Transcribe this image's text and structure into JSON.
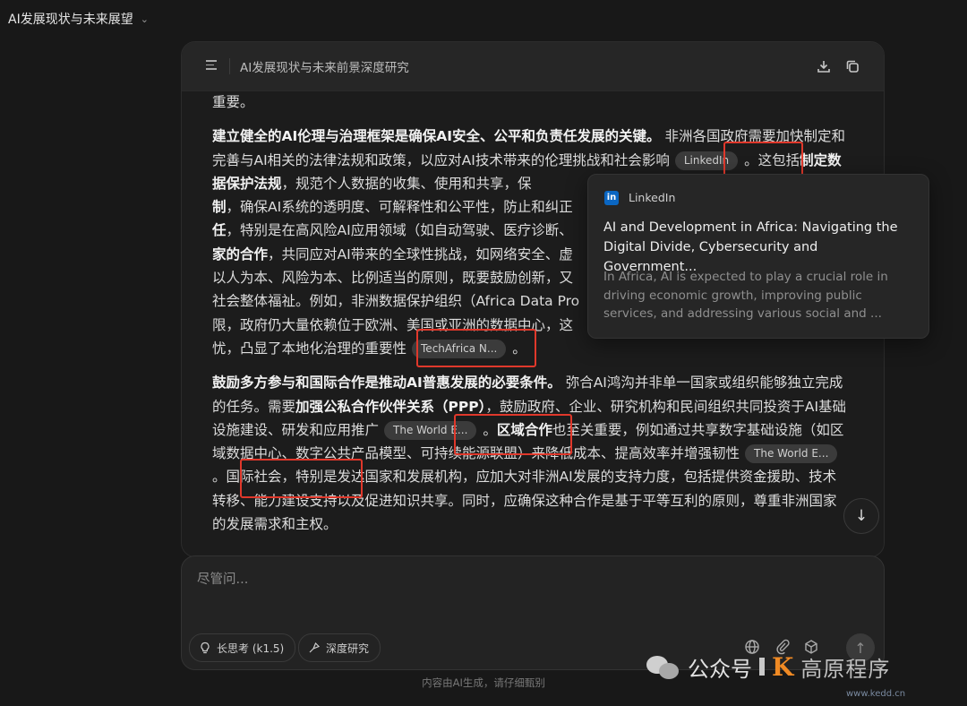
{
  "top_bar": {
    "title": "AI发展现状与未来展望",
    "dropdown_icon": "chevron-down-icon"
  },
  "card": {
    "title": "AI发展现状与未来前景深度研究",
    "icons": [
      "menu-icon",
      "download-icon",
      "copy-icon"
    ]
  },
  "article": {
    "p0": {
      "t1": "重要。"
    },
    "p1": {
      "b1": "建立健全的AI伦理与治理框架是确保AI安全、公平和负责任发展的关键。",
      "t1": "非洲各国政府需要加快制定和完善与AI相关的法律法规和政策，以应对AI技术带来的伦理挑战和社会影响",
      "chip1": "LinkedIn",
      "t2": "。这包括",
      "b2": "制定数据保护法规",
      "t3": "，规范个人数据的收集、使用和共享，保",
      "b3": "制",
      "t4": "，确保AI系统的透明度、可解释性和公平性，防止和纠正",
      "b4": "任",
      "t5": "，特别是在高风险AI应用领域（如自动驾驶、医疗诊断、",
      "b5": "家的合作",
      "t6": "，共同应对AI带来的全球性挑战，如网络安全、虚",
      "t7": "以人为本、风险为本、比例适当的原则，既要鼓励创新，又",
      "t8": "社会整体福祉。例如，非洲数据保护组织（Africa Data Pro",
      "t9": "限，政府仍大量依赖位于欧洲、美国或亚洲的数据中心，这",
      "t10": "忧，凸显了本地化治理的重要性",
      "chip2": "TechAfrica N...",
      "t11": "。"
    },
    "p2": {
      "b1": "鼓励多方参与和国际合作是推动AI普惠发展的必要条件。",
      "t1": "弥合AI鸿沟并非单一国家或组织能够独立完成的任务。需要",
      "b2": "加强公私合作伙伴关系（PPP）",
      "t2": "，鼓励政府、企业、研究机构和民间组织共同投资于AI基础设施建设、研发和应用推广",
      "chip1": "The World E...",
      "t3": "。",
      "b3": "区域合作",
      "t4": "也至关重要，例如通过共享数字基础设施（如区域数据中心、数字公共产品模型、可持续能源联盟）来降低成本、提高效率并增强韧性",
      "chip2": "The World E...",
      "t5": "。国际社会，特别是发达国家和发展机构，应加大对非洲AI发展的支持力度，包括提供资金援助、技术转移、能力建设支持以及促进知识共享。同时，应确保这种合作是基于平等互利的原则，尊重非洲国家的发展需求和主权。"
    }
  },
  "popover": {
    "source": "LinkedIn",
    "source_icon": "linkedin-icon",
    "title": "AI and Development in Africa: Navigating the Digital Divide, Cybersecurity and Government...",
    "description": "In Africa, AI is expected to play a crucial role in driving economic growth, improving public services, and addressing various social and ..."
  },
  "input": {
    "placeholder": "尽管问...",
    "pill_long_think": "长思考 (k1.5)",
    "pill_deep_research": "深度研究",
    "tools": [
      "globe-icon",
      "paperclip-icon",
      "cube-icon"
    ],
    "send_icon": "arrow-up-icon"
  },
  "footer": "内容由AI生成，请仔细甄别",
  "watermark": {
    "label": "公众号",
    "logo": "K",
    "brand": "高原程序",
    "url": "www.kedd.cn"
  },
  "colors": {
    "background": "#181818",
    "highlight": "#e0382b",
    "linkedin": "#0a66c2",
    "watermark_accent": "#f08a24"
  }
}
